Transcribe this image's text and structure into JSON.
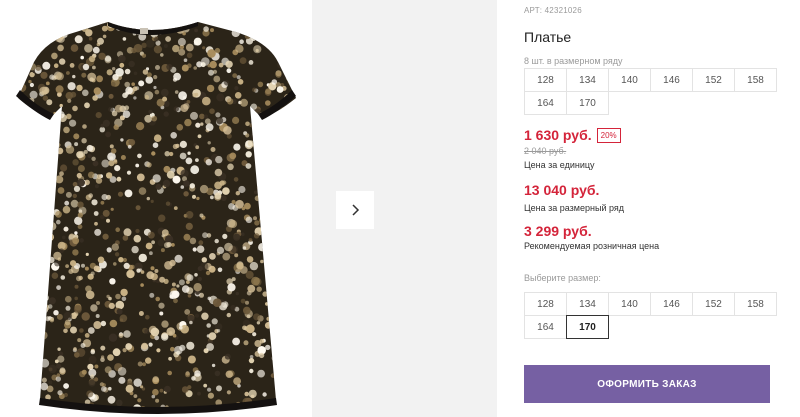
{
  "product": {
    "article": "АРТ: 42321026",
    "title": "Платье",
    "pack_note": "8 шт. в размерном ряду",
    "image_name": "sequin-dress-photo"
  },
  "size_row_sizes": [
    "128",
    "134",
    "140",
    "146",
    "152",
    "158",
    "164",
    "170"
  ],
  "pricing": {
    "price": "1 630 руб.",
    "discount": "20%",
    "old_price": "2 040 руб.",
    "unit_label": "Цена за единицу",
    "row_price": "13 040 руб.",
    "row_label": "Цена за размерный ряд",
    "rrp": "3 299 руб.",
    "rrp_label": "Рекомендуемая розничная цена"
  },
  "size_picker": {
    "label": "Выберите размер:",
    "sizes": [
      "128",
      "134",
      "140",
      "146",
      "152",
      "158",
      "164",
      "170"
    ],
    "selected": "170"
  },
  "gallery": {
    "next_icon": "chevron-right-icon"
  },
  "order_button": {
    "label": "ОФОРМИТЬ ЗАКАЗ"
  },
  "colors": {
    "accent": "#7660a3",
    "price": "#d4243a"
  }
}
